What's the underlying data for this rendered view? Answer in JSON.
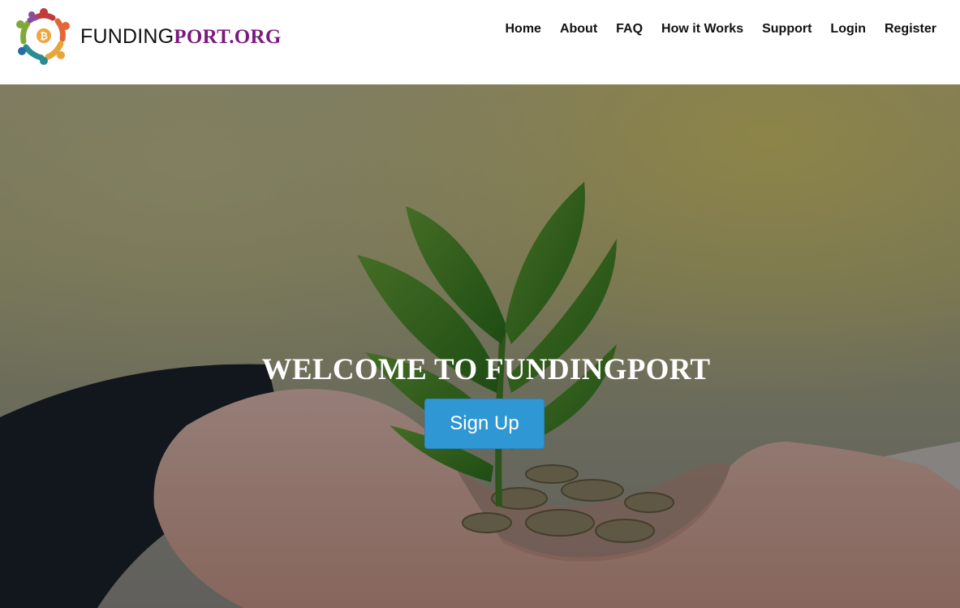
{
  "brand": {
    "name_part1": "FUNDING",
    "name_part2": "PORT.ORG",
    "logo_icon": "people-circle-bitcoin-logo",
    "accent_color": "#7b1a7e"
  },
  "nav": {
    "items": [
      "Home",
      "About",
      "FAQ",
      "How it Works",
      "Support",
      "Login",
      "Register"
    ]
  },
  "hero": {
    "title": "WELCOME TO FUNDINGPORT",
    "cta_label": "Sign Up",
    "cta_color": "#2f97d4",
    "background": "hands-holding-plant-and-coins-photo"
  }
}
